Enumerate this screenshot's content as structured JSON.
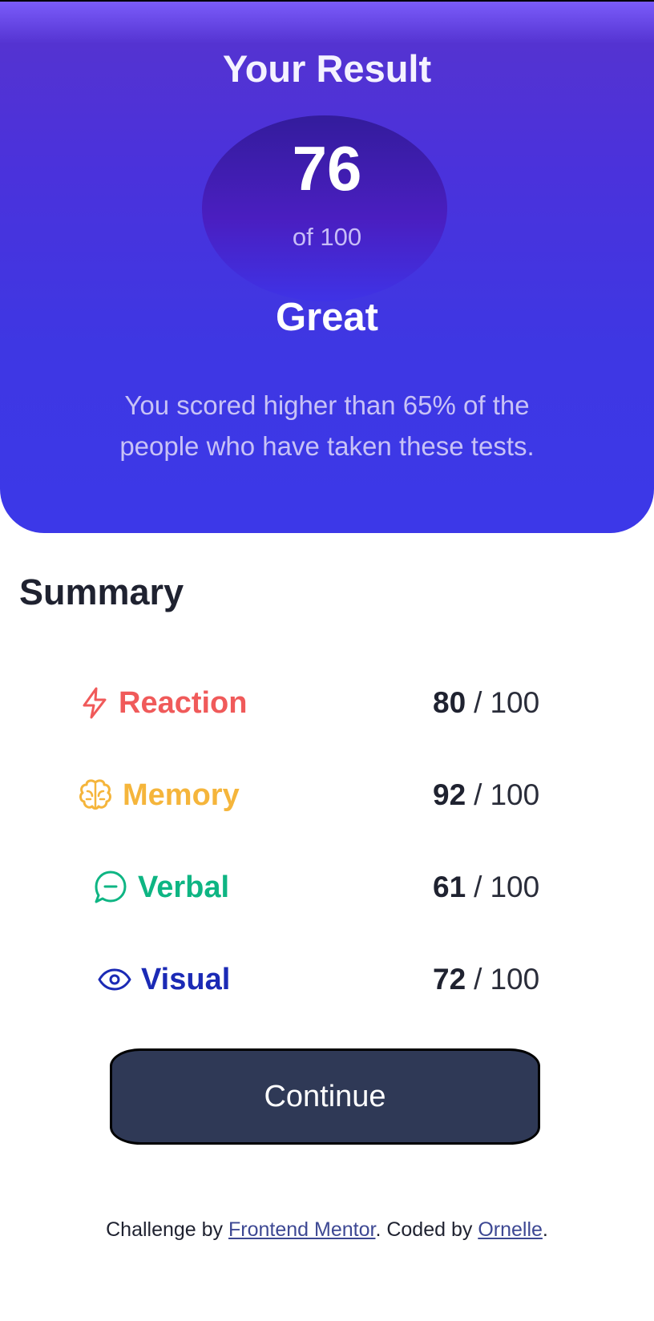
{
  "result": {
    "title": "Your Result",
    "score": "76",
    "score_total": "of 100",
    "rating": "Great",
    "description": "You scored higher than 65% of the people who have taken these tests."
  },
  "summary": {
    "title": "Summary",
    "items": [
      {
        "label": "Reaction",
        "icon": "lightning-icon",
        "color": "#f05a5a",
        "score": "80",
        "separator": "/",
        "max": "100"
      },
      {
        "label": "Memory",
        "icon": "brain-icon",
        "color": "#f5b53b",
        "score": "92",
        "separator": "/",
        "max": "100"
      },
      {
        "label": "Verbal",
        "icon": "chat-bubble-icon",
        "color": "#0eb583",
        "score": "61",
        "separator": "/",
        "max": "100"
      },
      {
        "label": "Visual",
        "icon": "eye-icon",
        "color": "#1b2ab5",
        "score": "72",
        "separator": "/",
        "max": "100"
      }
    ]
  },
  "continue_label": "Continue",
  "footer": {
    "prefix": "Challenge by ",
    "link1": "Frontend Mentor",
    "middle": ". Coded by ",
    "link2": "Ornelle",
    "suffix": "."
  }
}
